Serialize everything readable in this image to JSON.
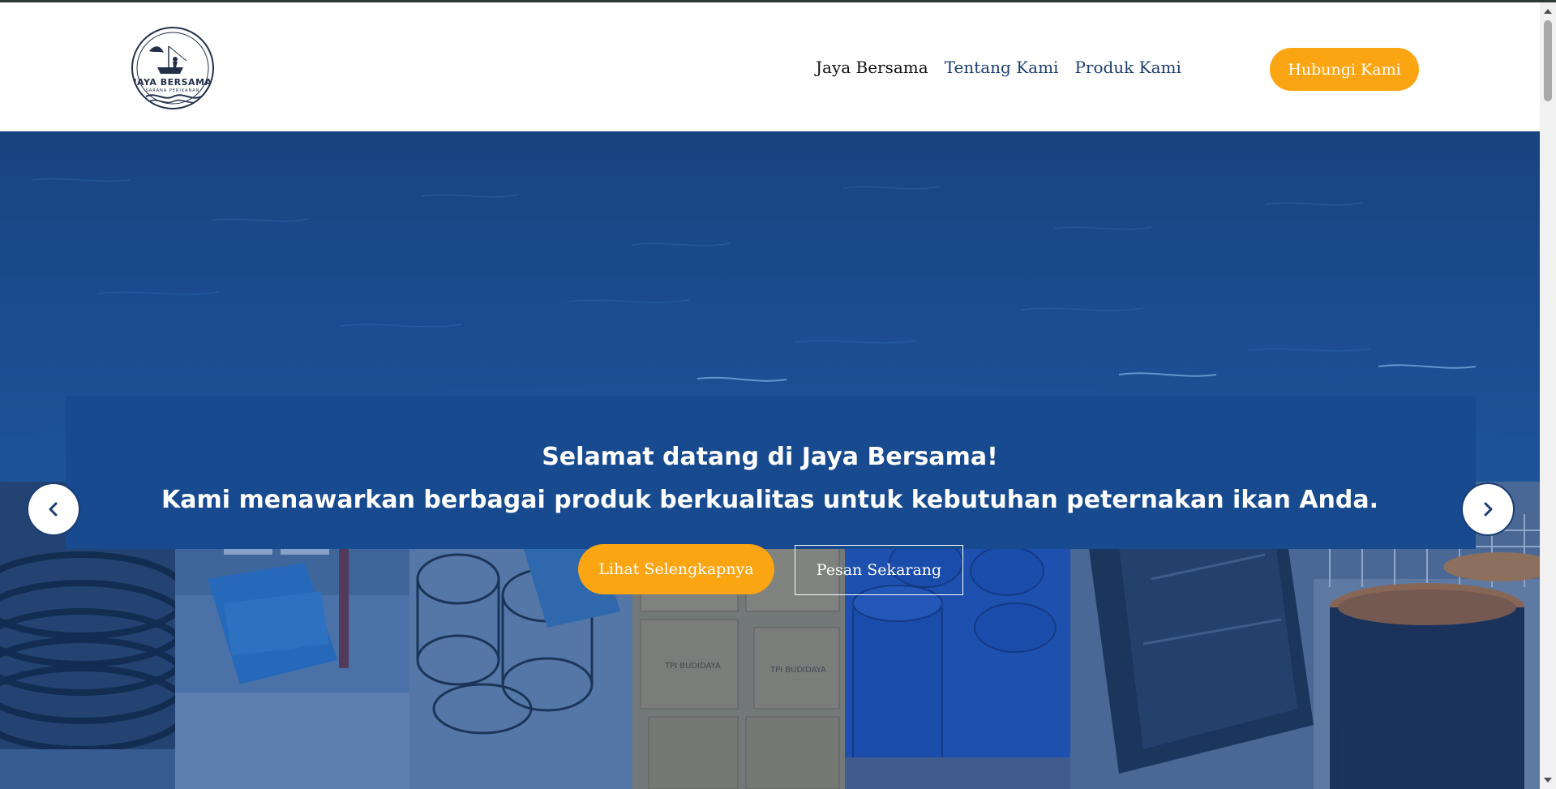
{
  "brand": {
    "name": "JAYA BERSAMA",
    "subtitle": "SARANA PERIKANAN",
    "primary_color": "#1a4991",
    "accent_color": "#fba512"
  },
  "nav": {
    "items": [
      {
        "label": "Jaya Bersama",
        "active": true
      },
      {
        "label": "Tentang Kami",
        "active": false
      },
      {
        "label": "Produk Kami",
        "active": false
      }
    ],
    "contact_label": "Hubungi Kami"
  },
  "hero": {
    "welcome": "Selamat datang di Jaya Bersama!",
    "tagline": "Kami menawarkan berbagai produk berkualitas untuk kebutuhan peternakan ikan Anda.",
    "primary_button": "Lihat Selengkapnya",
    "secondary_button": "Pesan Sekarang",
    "prev_icon": "chevron-left-icon",
    "next_icon": "chevron-right-icon",
    "product_photos": [
      {
        "subject": "coiled black hose pipes"
      },
      {
        "subject": "blue plastic panels"
      },
      {
        "subject": "wire fish cages"
      },
      {
        "subject": "labelled TPI Budidaya boxes",
        "label": "TPI BUDIDAYA"
      },
      {
        "subject": "blue plastic drums"
      },
      {
        "subject": "black tarpaulin pond liner"
      },
      {
        "subject": "round orange-rimmed fish tanks"
      }
    ]
  }
}
